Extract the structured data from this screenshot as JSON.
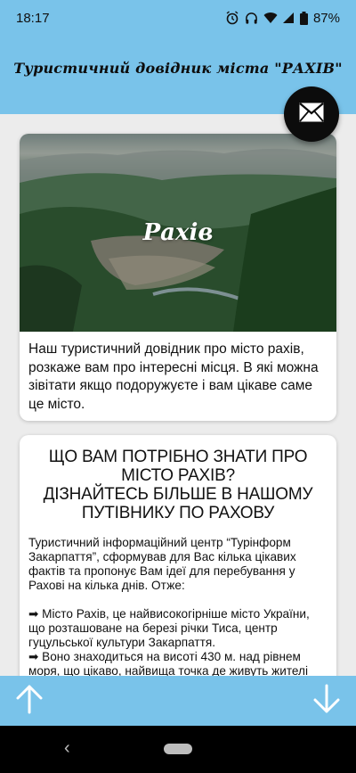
{
  "status_bar": {
    "time": "18:17",
    "battery": "87%",
    "icons": [
      "alarm-icon",
      "headphones-icon",
      "wifi-icon",
      "signal-icon",
      "battery-icon"
    ]
  },
  "app_bar": {
    "title": "Туристичний довідник міста \"РАХІВ\""
  },
  "fab": {
    "icon": "mail-icon"
  },
  "card_intro": {
    "image_title": "Рахів",
    "description": "Наш туристичний довідник про місто рахів, розкаже вам про інтересні місця. В які можна зівітати якщо подоружуєте і вам цікаве саме це місто."
  },
  "card_info": {
    "heading_line1": "ЩО ВАМ ПОТРІБНО ЗНАТИ ПРО МІСТО РАХІВ?",
    "heading_line2": "ДІЗНАЙТЕСЬ БІЛЬШЕ В НАШОМУ ПУТІВНИКУ ПО РАХОВУ",
    "intro": "Туристичний інформаційний центр “Турінформ Закарпаття”, сформував для Вас кілька цікавих фактів та пропонує Вам ідеї для перебування у Рахові на кілька днів. Отже:",
    "fact1": "➡ Місто Рахів, це найвисокогірніше місто України, що розташоване на березі річки Тиса, центр гуцульської культури Закарпаття.",
    "fact2": "➡ Воно знаходиться на висоті 430 м. над рівнем моря, що цікаво, найвища точка де живуть жителі"
  },
  "bottom_bar": {
    "up_icon": "arrow-up-icon",
    "down_icon": "arrow-down-icon"
  },
  "colors": {
    "accent": "#79c3ea",
    "fab": "#0c0c0c",
    "background": "#ececec",
    "card": "#ffffff"
  }
}
